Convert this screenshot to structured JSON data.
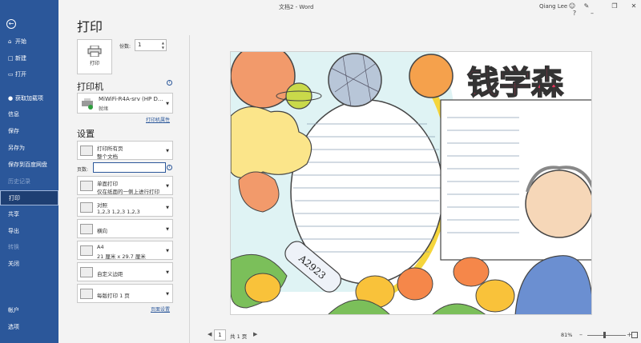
{
  "window": {
    "title": "文档2 - Word",
    "user": "Qiang Lee"
  },
  "nav": {
    "back_icon": "back-arrow-icon",
    "items": [
      {
        "label": "开始",
        "icon": "home-icon",
        "state": "normal"
      },
      {
        "label": "新建",
        "icon": "new-doc-icon",
        "state": "normal"
      },
      {
        "label": "打开",
        "icon": "folder-icon",
        "state": "normal"
      },
      {
        "label": "获取加载项",
        "icon": "addin-icon",
        "state": "normal"
      },
      {
        "label": "信息",
        "state": "normal"
      },
      {
        "label": "保存",
        "state": "normal"
      },
      {
        "label": "另存为",
        "state": "normal"
      },
      {
        "label": "保存到百度网盘",
        "state": "normal"
      },
      {
        "label": "历史记录",
        "state": "disabled"
      },
      {
        "label": "打印",
        "state": "active"
      },
      {
        "label": "共享",
        "state": "normal"
      },
      {
        "label": "导出",
        "state": "normal"
      },
      {
        "label": "转换",
        "state": "disabled"
      },
      {
        "label": "关闭",
        "state": "normal"
      },
      {
        "label": "帐户",
        "state": "normal"
      },
      {
        "label": "选项",
        "state": "normal"
      }
    ]
  },
  "print": {
    "heading": "打印",
    "button_label": "打印",
    "copies_label": "份数:",
    "copies_value": "1"
  },
  "printer": {
    "section_title": "打印机",
    "name": "MiWiFi-R4A-srv (HP D...",
    "status": "就绪",
    "properties_link": "打印机属性"
  },
  "settings": {
    "section_title": "设置",
    "range": {
      "line1": "打印所有页",
      "line2": "整个文档"
    },
    "pages_label": "页数:",
    "pages_value": "",
    "sides": {
      "line1": "单面打印",
      "line2": "仅在纸面的一侧上进行打印"
    },
    "collate": {
      "line1": "对照",
      "line2": "1,2,3    1,2,3    1,2,3"
    },
    "orientation": {
      "label": "横向"
    },
    "paper": {
      "line1": "A4",
      "line2": "21 厘米 x 29.7 厘米"
    },
    "margins": {
      "label": "自定义边距"
    },
    "per_sheet": {
      "label": "每版打印 1 页"
    },
    "page_setup_link": "页面设置"
  },
  "preview": {
    "title_text": "钱学森",
    "rocket_label": "A2923"
  },
  "status": {
    "page_current": "1",
    "page_total": "共 1 页",
    "zoom": "81%"
  },
  "colors": {
    "accent": "#2b579a",
    "nav_active": "#1e3f73",
    "pane_bg": "#f3f3f3",
    "poster_title": "#e8365d"
  }
}
